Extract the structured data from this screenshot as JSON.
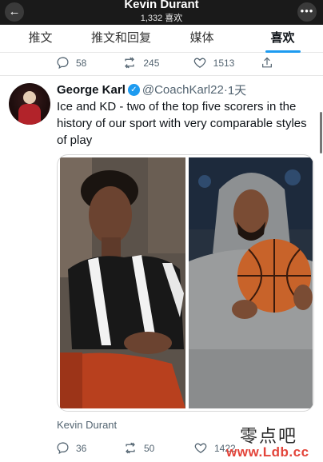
{
  "header": {
    "title": "Kevin Durant",
    "subtitle": "1,332 喜欢",
    "back_icon": "arrow-left-icon",
    "more_icon": "more-horizontal-icon"
  },
  "tabs": [
    {
      "label": "推文",
      "active": false
    },
    {
      "label": "推文和回复",
      "active": false
    },
    {
      "label": "媒体",
      "active": false
    },
    {
      "label": "喜欢",
      "active": true
    }
  ],
  "accent_color": "#1d9bf0",
  "prev_tweet": {
    "replies": "58",
    "retweets": "245",
    "likes": "1513"
  },
  "tweet": {
    "author_name": "George Karl",
    "handle": "@CoachKarl22",
    "separator": " · ",
    "time": "1天",
    "text": "Ice and KD - two of the top five scorers in the history of our sport with very comparable styles of play",
    "media_caption": "Kevin Durant",
    "replies": "36",
    "retweets": "50",
    "likes": "1422"
  },
  "watermark": {
    "text": "零点吧",
    "url": "www.Ldb.cc"
  }
}
